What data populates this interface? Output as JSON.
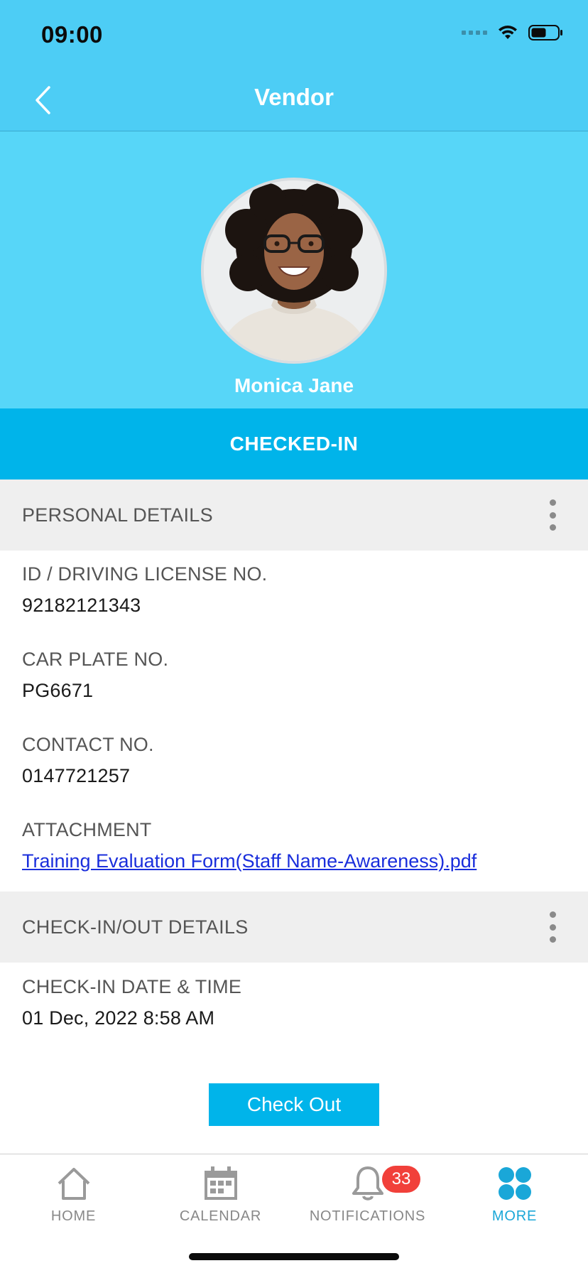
{
  "status_bar": {
    "time": "09:00"
  },
  "nav": {
    "title": "Vendor"
  },
  "profile": {
    "name": "Monica Jane"
  },
  "status_banner": "CHECKED-IN",
  "personal_details": {
    "title": "PERSONAL DETAILS",
    "fields": [
      {
        "label": "ID / DRIVING LICENSE NO.",
        "value": "92182121343"
      },
      {
        "label": "CAR PLATE NO.",
        "value": "PG6671"
      },
      {
        "label": "CONTACT NO.",
        "value": "0147721257"
      },
      {
        "label": "ATTACHMENT",
        "value": "Training Evaluation Form(Staff Name-Awareness).pdf"
      }
    ]
  },
  "checkin_details": {
    "title": "CHECK-IN/OUT DETAILS",
    "fields": [
      {
        "label": "CHECK-IN DATE & TIME",
        "value": "01 Dec, 2022 8:58 AM"
      }
    ]
  },
  "actions": {
    "checkout_label": "Check Out"
  },
  "tabbar": {
    "items": [
      {
        "label": "HOME",
        "icon": "home-icon"
      },
      {
        "label": "CALENDAR",
        "icon": "calendar-icon"
      },
      {
        "label": "NOTIFICATIONS",
        "icon": "bell-icon",
        "badge": "33"
      },
      {
        "label": "MORE",
        "icon": "more-grid-icon",
        "active": true
      }
    ]
  },
  "colors": {
    "header": "#4dcdf5",
    "profile_bg": "#57d6f8",
    "accent": "#00b4ea",
    "badge": "#f1403a",
    "link": "#1a2edc"
  }
}
